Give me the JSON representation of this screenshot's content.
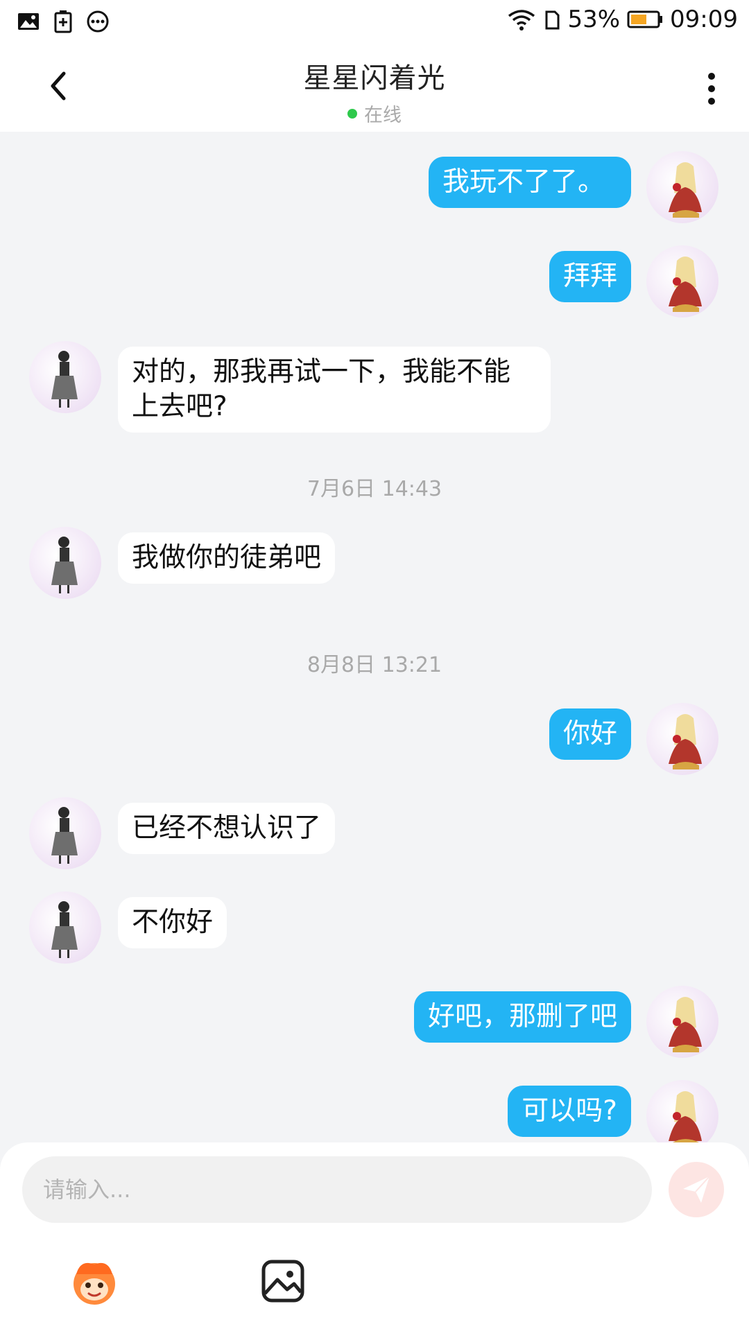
{
  "status_bar": {
    "battery": "53%",
    "time": "09:09",
    "icons_left": [
      "image-icon",
      "battery-saver-icon",
      "more-dots-icon"
    ],
    "icons_right": [
      "wifi-icon",
      "sim-icon",
      "battery-icon"
    ]
  },
  "header": {
    "title": "星星闪着光",
    "status": "在线",
    "online_color": "#2ec94c"
  },
  "colors": {
    "outgoing_bubble": "#23b4f4",
    "incoming_bubble": "#ffffff",
    "background": "#f3f4f6"
  },
  "messages": [
    {
      "side": "out",
      "text": "我玩不了了。"
    },
    {
      "side": "out",
      "text": "拜拜"
    },
    {
      "side": "in",
      "text": "对的，那我再试一下，我能不能上去吧?"
    },
    {
      "type": "timestamp",
      "text": "7月6日 14:43"
    },
    {
      "side": "in",
      "text": "我做你的徒弟吧"
    },
    {
      "type": "timestamp",
      "text": "8月8日 13:21"
    },
    {
      "side": "out",
      "text": "你好"
    },
    {
      "side": "in",
      "text": "已经不想认识了"
    },
    {
      "side": "in",
      "text": "不你好"
    },
    {
      "side": "out",
      "text": "好吧，那删了吧"
    },
    {
      "side": "out",
      "text": "可以吗?"
    }
  ],
  "composer": {
    "placeholder": "请输入...",
    "tools": [
      "emoji-mascot-icon",
      "image-picker-icon"
    ]
  }
}
